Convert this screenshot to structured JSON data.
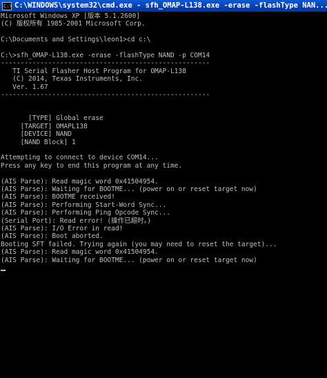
{
  "window": {
    "title": "C:\\WINDOWS\\system32\\cmd.exe - sfh_OMAP-L138.exe -erase -flashType NAN..."
  },
  "console": {
    "lines": [
      "Microsoft Windows XP [版本 5.1.2600]",
      "(C) 版权所有 1985-2001 Microsoft Corp.",
      "",
      "C:\\Documents and Settings\\leon1>cd c:\\",
      "",
      "C:\\>sfh_OMAP-L138.exe -erase -flashType NAND -p COM14",
      "-----------------------------------------------------",
      "   TI Serial Flasher Host Program for OMAP-L138",
      "   (C) 2014, Texas Instruments, Inc.",
      "   Ver. 1.67",
      "-----------------------------------------------------",
      "",
      "",
      "       [TYPE] Global erase",
      "     [TARGET] OMAPL138",
      "     [DEVICE] NAND",
      "     [NAND Block] 1",
      "",
      "Attempting to connect to device COM14...",
      "Press any key to end this program at any time.",
      "",
      "(AIS Parse): Read magic word 0x41504954.",
      "(AIS Parse): Waiting for BOOTME... (power on or reset target now)",
      "(AIS Parse): BOOTME received!",
      "(AIS Parse): Performing Start-Word Sync...",
      "(AIS Parse): Performing Ping Opcode Sync...",
      "(Serial Port): Read error! (操作已超时。)",
      "(AIS Parse): I/O Error in read!",
      "(AIS Parse): Boot aborted.",
      "Booting SFT failed. Trying again (you may need to reset the target)...",
      "(AIS Parse): Read magic word 0x41504954.",
      "(AIS Parse): Waiting for BOOTME... (power on or reset target now)"
    ]
  },
  "icons": {
    "window_icon": "cmd-icon"
  },
  "colors": {
    "titlebar": "#0a4fd0",
    "console_bg": "#000000",
    "console_text": "#c0c0c0"
  }
}
